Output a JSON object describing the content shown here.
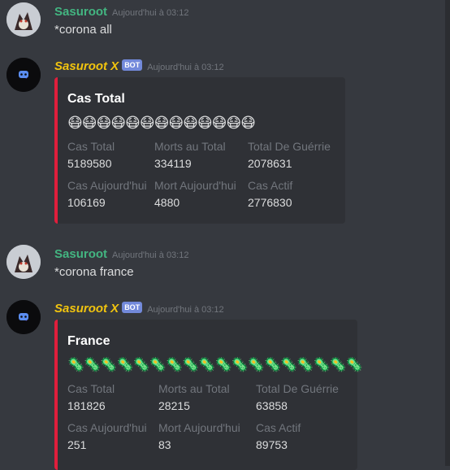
{
  "messages": [
    {
      "author": "Sasuroot",
      "timestamp": "Aujourd'hui à 03:12",
      "content": "*corona all"
    },
    {
      "author": "Sasuroot X",
      "badge": "BOT",
      "timestamp": "Aujourd'hui à 03:12",
      "embed": {
        "title": "Cas Total",
        "emoji_row": "😷😷😷😷😷😷😷😷😷😷😷😷😷",
        "fields": [
          {
            "name": "Cas Total",
            "value": "5189580"
          },
          {
            "name": "Morts au Total",
            "value": "334119"
          },
          {
            "name": "Total De Guérrie",
            "value": "2078631"
          },
          {
            "name": "Cas Aujourd'hui",
            "value": "106169"
          },
          {
            "name": "Mort Aujourd'hui",
            "value": "4880"
          },
          {
            "name": "Cas Actif",
            "value": "2776830"
          }
        ]
      }
    },
    {
      "author": "Sasuroot",
      "timestamp": "Aujourd'hui à 03:12",
      "content": "*corona france"
    },
    {
      "author": "Sasuroot X",
      "badge": "BOT",
      "timestamp": "Aujourd'hui à 03:12",
      "embed": {
        "title": "France",
        "emoji_row": "🦠🦠🦠🦠🦠🦠🦠🦠🦠🦠🦠🦠🦠🦠🦠🦠🦠🦠",
        "fields": [
          {
            "name": "Cas Total",
            "value": "181826"
          },
          {
            "name": "Morts au Total",
            "value": "28215"
          },
          {
            "name": "Total De Guérrie",
            "value": "63858"
          },
          {
            "name": "Cas Aujourd'hui",
            "value": "251"
          },
          {
            "name": "Mort Aujourd'hui",
            "value": "83"
          },
          {
            "name": "Cas Actif",
            "value": "89753"
          }
        ]
      }
    }
  ],
  "colors": {
    "background": "#36393f",
    "embed_bg": "#2f3136",
    "embed_border": "#e01e3c",
    "user_name": "#43b581",
    "bot_name": "#f1c40f",
    "badge": "#7289da"
  },
  "icons": {
    "user_avatar": "fox-avatar-icon",
    "bot_avatar": "discord-logo-icon"
  }
}
